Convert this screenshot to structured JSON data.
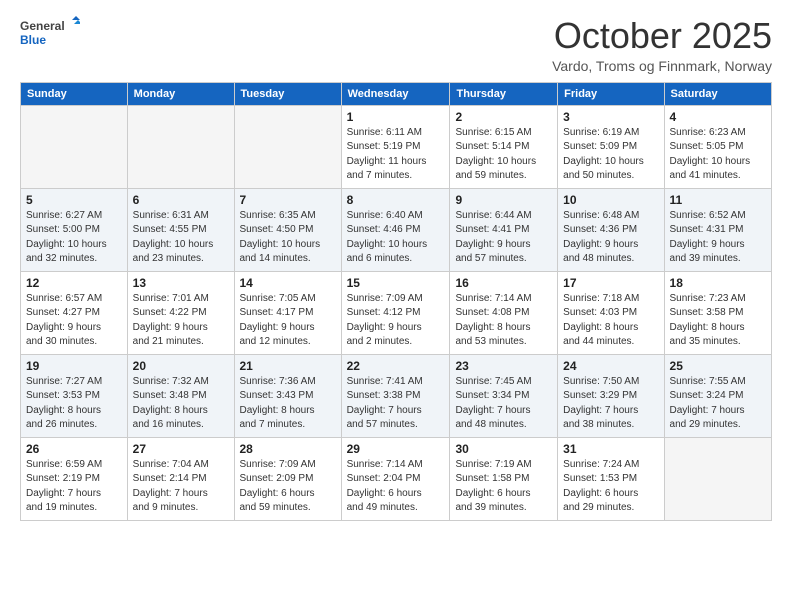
{
  "header": {
    "logo_line1": "General",
    "logo_line2": "Blue",
    "month": "October 2025",
    "location": "Vardo, Troms og Finnmark, Norway"
  },
  "weekdays": [
    "Sunday",
    "Monday",
    "Tuesday",
    "Wednesday",
    "Thursday",
    "Friday",
    "Saturday"
  ],
  "weeks": [
    [
      {
        "day": "",
        "detail": ""
      },
      {
        "day": "",
        "detail": ""
      },
      {
        "day": "",
        "detail": ""
      },
      {
        "day": "1",
        "detail": "Sunrise: 6:11 AM\nSunset: 5:19 PM\nDaylight: 11 hours\nand 7 minutes."
      },
      {
        "day": "2",
        "detail": "Sunrise: 6:15 AM\nSunset: 5:14 PM\nDaylight: 10 hours\nand 59 minutes."
      },
      {
        "day": "3",
        "detail": "Sunrise: 6:19 AM\nSunset: 5:09 PM\nDaylight: 10 hours\nand 50 minutes."
      },
      {
        "day": "4",
        "detail": "Sunrise: 6:23 AM\nSunset: 5:05 PM\nDaylight: 10 hours\nand 41 minutes."
      }
    ],
    [
      {
        "day": "5",
        "detail": "Sunrise: 6:27 AM\nSunset: 5:00 PM\nDaylight: 10 hours\nand 32 minutes."
      },
      {
        "day": "6",
        "detail": "Sunrise: 6:31 AM\nSunset: 4:55 PM\nDaylight: 10 hours\nand 23 minutes."
      },
      {
        "day": "7",
        "detail": "Sunrise: 6:35 AM\nSunset: 4:50 PM\nDaylight: 10 hours\nand 14 minutes."
      },
      {
        "day": "8",
        "detail": "Sunrise: 6:40 AM\nSunset: 4:46 PM\nDaylight: 10 hours\nand 6 minutes."
      },
      {
        "day": "9",
        "detail": "Sunrise: 6:44 AM\nSunset: 4:41 PM\nDaylight: 9 hours\nand 57 minutes."
      },
      {
        "day": "10",
        "detail": "Sunrise: 6:48 AM\nSunset: 4:36 PM\nDaylight: 9 hours\nand 48 minutes."
      },
      {
        "day": "11",
        "detail": "Sunrise: 6:52 AM\nSunset: 4:31 PM\nDaylight: 9 hours\nand 39 minutes."
      }
    ],
    [
      {
        "day": "12",
        "detail": "Sunrise: 6:57 AM\nSunset: 4:27 PM\nDaylight: 9 hours\nand 30 minutes."
      },
      {
        "day": "13",
        "detail": "Sunrise: 7:01 AM\nSunset: 4:22 PM\nDaylight: 9 hours\nand 21 minutes."
      },
      {
        "day": "14",
        "detail": "Sunrise: 7:05 AM\nSunset: 4:17 PM\nDaylight: 9 hours\nand 12 minutes."
      },
      {
        "day": "15",
        "detail": "Sunrise: 7:09 AM\nSunset: 4:12 PM\nDaylight: 9 hours\nand 2 minutes."
      },
      {
        "day": "16",
        "detail": "Sunrise: 7:14 AM\nSunset: 4:08 PM\nDaylight: 8 hours\nand 53 minutes."
      },
      {
        "day": "17",
        "detail": "Sunrise: 7:18 AM\nSunset: 4:03 PM\nDaylight: 8 hours\nand 44 minutes."
      },
      {
        "day": "18",
        "detail": "Sunrise: 7:23 AM\nSunset: 3:58 PM\nDaylight: 8 hours\nand 35 minutes."
      }
    ],
    [
      {
        "day": "19",
        "detail": "Sunrise: 7:27 AM\nSunset: 3:53 PM\nDaylight: 8 hours\nand 26 minutes."
      },
      {
        "day": "20",
        "detail": "Sunrise: 7:32 AM\nSunset: 3:48 PM\nDaylight: 8 hours\nand 16 minutes."
      },
      {
        "day": "21",
        "detail": "Sunrise: 7:36 AM\nSunset: 3:43 PM\nDaylight: 8 hours\nand 7 minutes."
      },
      {
        "day": "22",
        "detail": "Sunrise: 7:41 AM\nSunset: 3:38 PM\nDaylight: 7 hours\nand 57 minutes."
      },
      {
        "day": "23",
        "detail": "Sunrise: 7:45 AM\nSunset: 3:34 PM\nDaylight: 7 hours\nand 48 minutes."
      },
      {
        "day": "24",
        "detail": "Sunrise: 7:50 AM\nSunset: 3:29 PM\nDaylight: 7 hours\nand 38 minutes."
      },
      {
        "day": "25",
        "detail": "Sunrise: 7:55 AM\nSunset: 3:24 PM\nDaylight: 7 hours\nand 29 minutes."
      }
    ],
    [
      {
        "day": "26",
        "detail": "Sunrise: 6:59 AM\nSunset: 2:19 PM\nDaylight: 7 hours\nand 19 minutes."
      },
      {
        "day": "27",
        "detail": "Sunrise: 7:04 AM\nSunset: 2:14 PM\nDaylight: 7 hours\nand 9 minutes."
      },
      {
        "day": "28",
        "detail": "Sunrise: 7:09 AM\nSunset: 2:09 PM\nDaylight: 6 hours\nand 59 minutes."
      },
      {
        "day": "29",
        "detail": "Sunrise: 7:14 AM\nSunset: 2:04 PM\nDaylight: 6 hours\nand 49 minutes."
      },
      {
        "day": "30",
        "detail": "Sunrise: 7:19 AM\nSunset: 1:58 PM\nDaylight: 6 hours\nand 39 minutes."
      },
      {
        "day": "31",
        "detail": "Sunrise: 7:24 AM\nSunset: 1:53 PM\nDaylight: 6 hours\nand 29 minutes."
      },
      {
        "day": "",
        "detail": ""
      }
    ]
  ]
}
